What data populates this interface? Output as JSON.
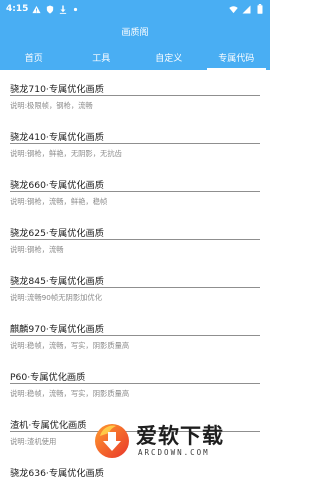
{
  "status_bar": {
    "time": "4:15",
    "icons": [
      "warning-icon",
      "shield-icon",
      "download-icon",
      "dot-icon",
      "wifi-icon",
      "signal-icon",
      "battery-icon"
    ]
  },
  "app_bar": {
    "title": "画质阁"
  },
  "tabs": [
    {
      "label": "首页",
      "active": false
    },
    {
      "label": "工具",
      "active": false
    },
    {
      "label": "自定义",
      "active": false
    },
    {
      "label": "专属代码",
      "active": true
    }
  ],
  "items": [
    {
      "title": "骁龙710·专属优化画质",
      "desc": "说明:极限帧，钢枪，流畅"
    },
    {
      "title": "骁龙410·专属优化画质",
      "desc": "说明:钢枪，鲜艳，无阴影，无抗齿"
    },
    {
      "title": "骁龙660·专属优化画质",
      "desc": "说明:钢枪，流畅，鲜艳，稳帧"
    },
    {
      "title": "骁龙625·专属优化画质",
      "desc": "说明:钢枪，流畅"
    },
    {
      "title": "骁龙845·专属优化画质",
      "desc": "说明:流畅90帧无阴影加优化"
    },
    {
      "title": "麒麟970·专属优化画质",
      "desc": "说明:稳帧，流畅，写实，阴影质量高"
    },
    {
      "title": "P60·专属优化画质",
      "desc": "说明:稳帧，流畅，写实，阴影质量高"
    },
    {
      "title": "渣机·专属优化画质",
      "desc": "说明:渣机使用"
    },
    {
      "title": "骁龙636·专属优化画质",
      "desc": ""
    }
  ],
  "watermark": {
    "name": "爱软下载",
    "url": "ARCDOWN.COM"
  },
  "colors": {
    "primary": "#49aef3",
    "title_text": "#202020",
    "desc_text": "#8a8a8a"
  }
}
